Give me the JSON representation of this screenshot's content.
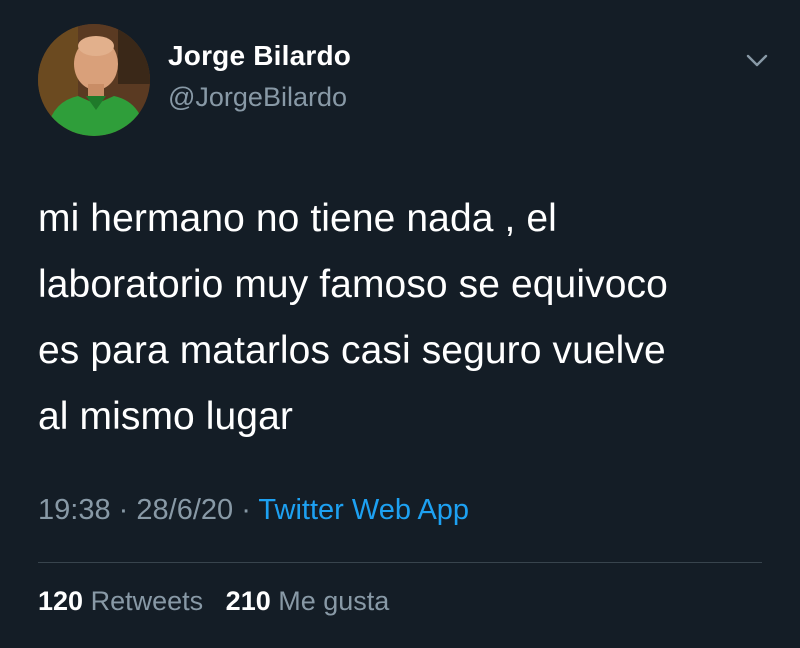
{
  "tweet": {
    "author": {
      "name": "Jorge Bilardo",
      "handle": "@JorgeBilardo"
    },
    "text": "mi hermano no tiene nada , el\nlaboratorio muy famoso se equivoco\nes para matarlos casi seguro vuelve\nal mismo lugar",
    "time": "19:38",
    "date": "28/6/20",
    "separator": "·",
    "source": "Twitter Web App",
    "stats": {
      "retweets_count": "120",
      "retweets_label": "Retweets",
      "likes_count": "210",
      "likes_label": "Me gusta"
    }
  },
  "icons": {
    "menu": "chevron-down-icon"
  },
  "colors": {
    "background": "#141d26",
    "text_primary": "#ffffff",
    "text_secondary": "#8899a6",
    "link": "#1da1f2",
    "divider": "#38444d"
  }
}
